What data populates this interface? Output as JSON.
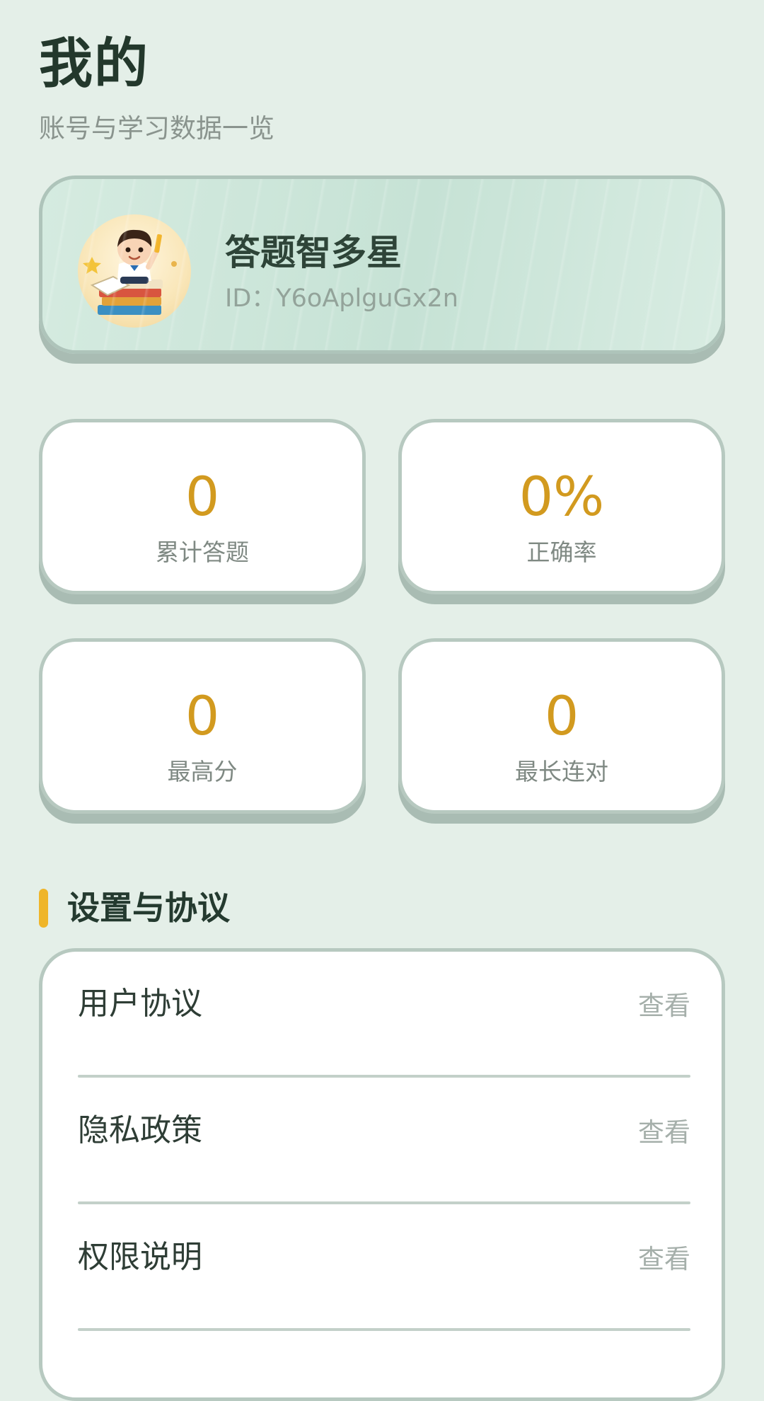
{
  "header": {
    "title": "我的",
    "subtitle": "账号与学习数据一览"
  },
  "profile": {
    "name": "答题智多星",
    "id_text": "ID：Y6oAplguGx2n",
    "avatar_icon": "avatar-cartoon-boy-books"
  },
  "stats": [
    {
      "value": "0",
      "label": "累计答题"
    },
    {
      "value": "0%",
      "label": "正确率"
    },
    {
      "value": "0",
      "label": "最高分"
    },
    {
      "value": "0",
      "label": "最长连对"
    }
  ],
  "settings": {
    "title": "设置与协议",
    "items": [
      {
        "label": "用户协议",
        "action": "查看"
      },
      {
        "label": "隐私政策",
        "action": "查看"
      },
      {
        "label": "权限说明",
        "action": "查看"
      }
    ]
  },
  "colors": {
    "background": "#e4efe8",
    "accent_value": "#d29a1f",
    "section_bar": "#efb52a",
    "card_border": "#b7c9c0"
  }
}
